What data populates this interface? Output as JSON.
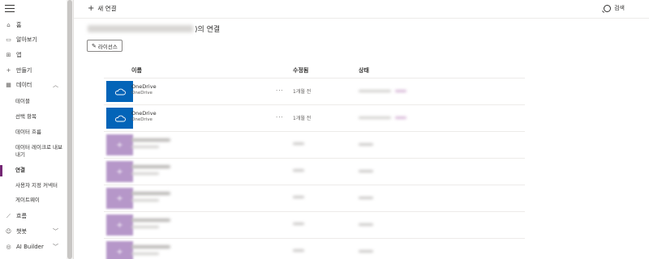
{
  "sidebar": {
    "items": [
      {
        "label": "홈",
        "icon": "home-icon"
      },
      {
        "label": "알아보기",
        "icon": "book-icon"
      },
      {
        "label": "앱",
        "icon": "apps-icon"
      },
      {
        "label": "만들기",
        "icon": "plus-icon"
      },
      {
        "label": "데이터",
        "icon": "table-icon"
      }
    ],
    "data_subitems": [
      "테이블",
      "선택 항목",
      "데이터 흐름",
      "데이터 레이크로 내보내기",
      "연결",
      "사용자 지정 커넥터",
      "게이트웨이"
    ],
    "bottom_items": [
      {
        "label": "흐름",
        "icon": "flow-icon"
      },
      {
        "label": "챗봇",
        "icon": "chatbot-icon"
      },
      {
        "label": "AI Builder",
        "icon": "ai-builder-icon"
      }
    ],
    "active": "연결",
    "accent": "#742774"
  },
  "topbar": {
    "new_connection": "새 연결",
    "search": "검색"
  },
  "page": {
    "title_suffix": ")의 연결",
    "license_button": "라이선스"
  },
  "table": {
    "headers": {
      "name": "이름",
      "modified": "수정됨",
      "status": "상태"
    },
    "rows": [
      {
        "name": "OneDrive",
        "sub": "OneDrive",
        "modified": "1개월 전",
        "more": "···"
      },
      {
        "name": "OneDrive",
        "sub": "OneDrive",
        "modified": "1개월 전",
        "more": "···"
      }
    ]
  },
  "colors": {
    "onedrive_tile": "#0364b8",
    "blurred_tile": "#b697c9"
  }
}
